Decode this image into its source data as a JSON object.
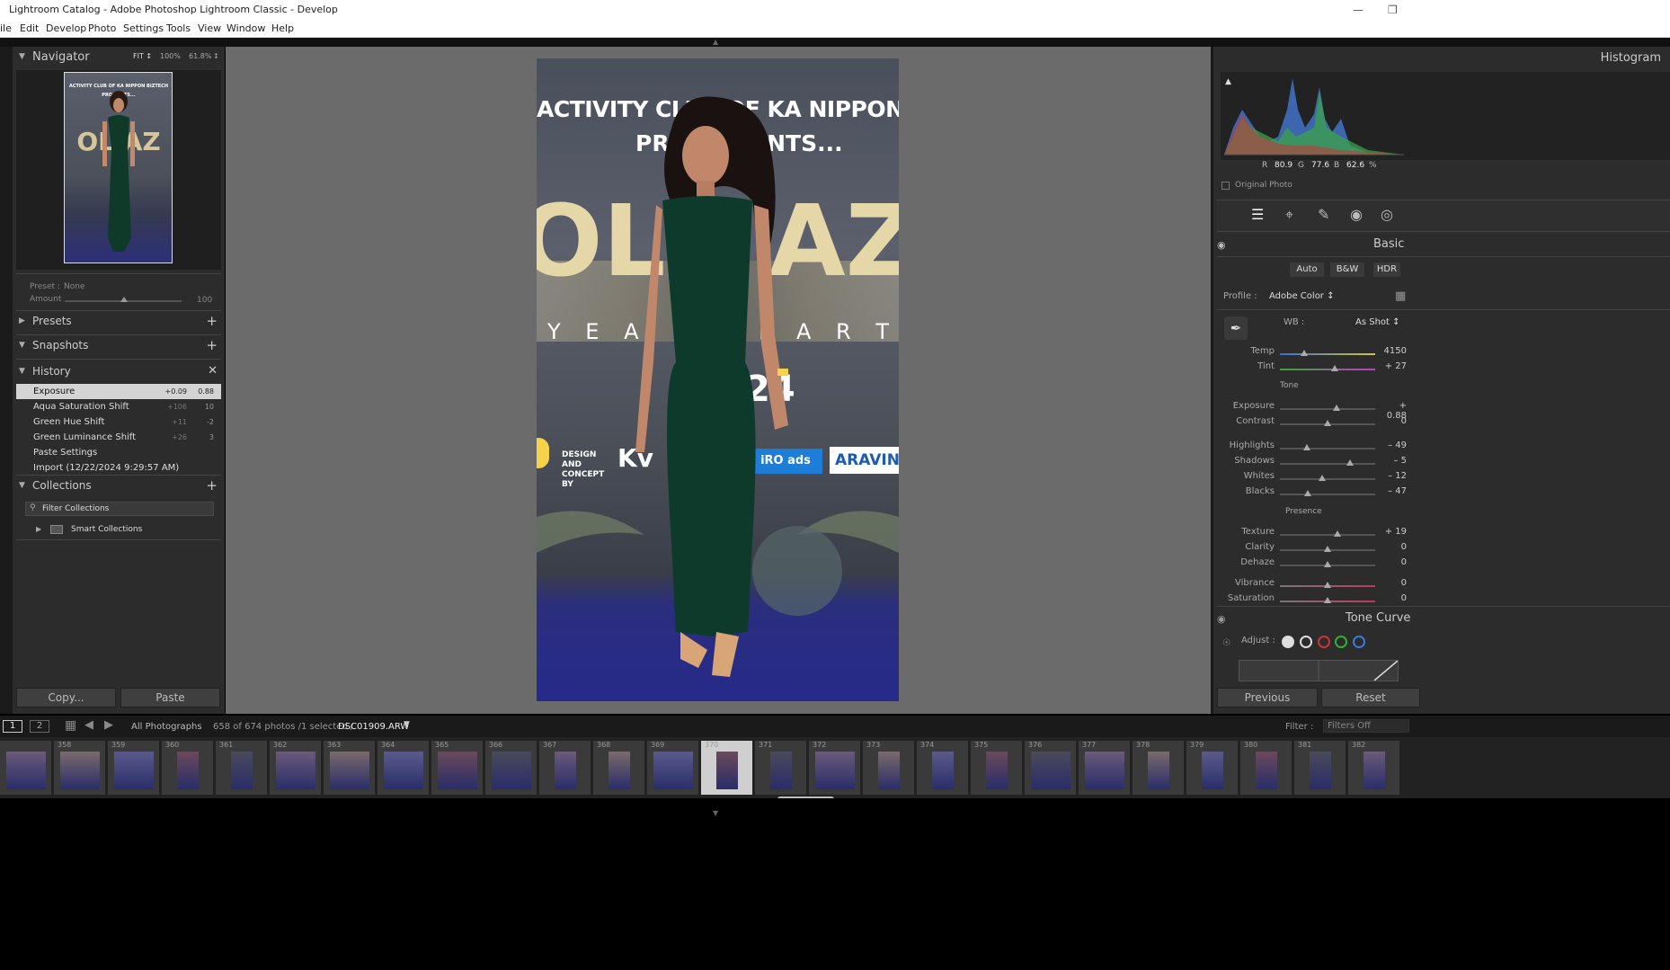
{
  "window": {
    "title": "Lightroom Catalog - Adobe Photoshop Lightroom Classic - Develop"
  },
  "menu": [
    "ile",
    "Edit",
    "Develop",
    "Photo",
    "Settings",
    "Tools",
    "View",
    "Window",
    "Help"
  ],
  "navigator": {
    "title": "Navigator",
    "fit": "FIT ↕",
    "zoom1": "100%",
    "zoom2": "61.8%",
    "zoom_arrows": "↕"
  },
  "preset": {
    "label": "Preset :",
    "value": "None",
    "amount_label": "Amount",
    "amount_value": "100",
    "amount": 1.0
  },
  "panels": {
    "presets": "Presets",
    "snapshots": "Snapshots",
    "history": "History",
    "collections": "Collections"
  },
  "history": [
    {
      "name": "Exposure",
      "a": "+0.09",
      "b": "0.88",
      "selected": true
    },
    {
      "name": "Aqua Saturation Shift",
      "a": "+106",
      "b": "10"
    },
    {
      "name": "Green Hue Shift",
      "a": "+11",
      "b": "-2"
    },
    {
      "name": "Green Luminance Shift",
      "a": "+26",
      "b": "3"
    },
    {
      "name": "Paste Settings",
      "a": "",
      "b": ""
    },
    {
      "name": "Import (12/22/2024 9:29:57 AM)",
      "a": "",
      "b": ""
    }
  ],
  "collections": {
    "filter": "Filter Collections",
    "smart": "Smart Collections"
  },
  "left_buttons": {
    "copy": "Copy...",
    "paste": "Paste"
  },
  "photo": {
    "line1": "ACTIVITY CLUB OF  KA NIPPON BIZTECH",
    "line2": "PRO      SENTS...",
    "big": "OL   AZ",
    "year": "Y E A       P A R T",
    "num": "24",
    "design": "DESIGN AND CONCEPT BY",
    "kv": "Kv",
    "iro": "iRO ads",
    "arav": "ARAVIN"
  },
  "histogram": {
    "title": "Histogram",
    "r_label": "R",
    "r": "80.9",
    "g_label": "G",
    "g": "77.6",
    "b_label": "B",
    "b": "62.6",
    "pct": "%",
    "original": "Original Photo"
  },
  "basic": {
    "title": "Basic",
    "auto": "Auto",
    "bw": "B&W",
    "hdr": "HDR",
    "profile_label": "Profile :",
    "profile": "Adobe Color ↕",
    "wb_label": "WB :",
    "wb": "As Shot ↕",
    "tone": "Tone",
    "presence": "Presence"
  },
  "sliders": [
    {
      "label": "Temp",
      "value": "4150",
      "pos": 0.25,
      "grad": "linear-gradient(90deg,#3a6fd0,#d6c23a)"
    },
    {
      "label": "Tint",
      "value": "+ 27",
      "pos": 0.58,
      "grad": "linear-gradient(90deg,#3aa63a,#c03ac0)"
    },
    {
      "label": "Exposure",
      "value": "+ 0.88",
      "pos": 0.59,
      "grad": "#555"
    },
    {
      "label": "Contrast",
      "value": "0",
      "pos": 0.5,
      "grad": "#555"
    },
    {
      "label": "Highlights",
      "value": "– 49",
      "pos": 0.28,
      "grad": "#555"
    },
    {
      "label": "Shadows",
      "value": "– 5",
      "pos": 0.74,
      "grad": "#555"
    },
    {
      "label": "Whites",
      "value": "– 12",
      "pos": 0.44,
      "grad": "#555"
    },
    {
      "label": "Blacks",
      "value": "– 47",
      "pos": 0.29,
      "grad": "#555"
    },
    {
      "label": "Texture",
      "value": "+ 19",
      "pos": 0.6,
      "grad": "#555"
    },
    {
      "label": "Clarity",
      "value": "0",
      "pos": 0.5,
      "grad": "#555"
    },
    {
      "label": "Dehaze",
      "value": "0",
      "pos": 0.5,
      "grad": "#555"
    },
    {
      "label": "Vibrance",
      "value": "0",
      "pos": 0.5,
      "grad": "linear-gradient(90deg,#777,#c03a5c)"
    },
    {
      "label": "Saturation",
      "value": "0",
      "pos": 0.5,
      "grad": "linear-gradient(90deg,#777,#c03a5c)"
    }
  ],
  "tonecurve": {
    "title": "Tone Curve",
    "adjust": "Adjust :"
  },
  "right_buttons": {
    "previous": "Previous",
    "reset": "Reset"
  },
  "filmbar": {
    "v1": "1",
    "v2": "2",
    "source": "All Photographs",
    "count": "658 of 674 photos /1 selected /",
    "file": "DSC01909.ARW",
    "filter_label": "Filter :",
    "filter_value": "Filters Off"
  },
  "film_numbers": [
    "",
    "358",
    "359",
    "360",
    "361",
    "362",
    "363",
    "364",
    "365",
    "366",
    "367",
    "368",
    "369",
    "370",
    "371",
    "372",
    "373",
    "374",
    "375",
    "376",
    "377",
    "378",
    "379",
    "380",
    "381",
    "382"
  ]
}
